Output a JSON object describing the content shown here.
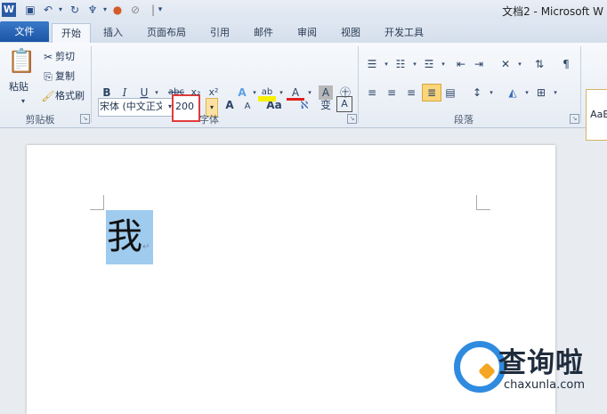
{
  "title_bar": {
    "app_icon": "W",
    "quick_access": [
      "save-icon",
      "undo-icon",
      "redo-icon",
      "format-painter-icon",
      "color-icon",
      "clear-icon",
      "customize-icon"
    ],
    "document_title": "文档2 - Microsoft W"
  },
  "tabs": [
    "文件",
    "开始",
    "插入",
    "页面布局",
    "引用",
    "邮件",
    "审阅",
    "视图",
    "开发工具"
  ],
  "active_tab": "开始",
  "clipboard": {
    "paste": "粘贴",
    "cut": "剪切",
    "copy": "复制",
    "format_painter": "格式刷",
    "label": "剪贴板"
  },
  "font": {
    "font_name": "宋体 (中文正文)",
    "font_size": "200",
    "grow": "A",
    "shrink": "A",
    "change_case": "Aa",
    "bold": "B",
    "italic": "I",
    "underline": "U",
    "strikethrough": "abc",
    "subscript": "x₂",
    "superscript": "x²",
    "text_effect": "A",
    "highlight": "ab",
    "font_color": "A",
    "char_shading": "A",
    "label": "字体",
    "phonetic": "变",
    "border": "A"
  },
  "paragraph": {
    "label": "段落"
  },
  "styles": {
    "preview": "AaB"
  },
  "document": {
    "text": "我",
    "paragraph_mark": "↵"
  },
  "watermark": {
    "title": "查询啦",
    "url": "chaxunla.com"
  },
  "colors": {
    "file_tab": "#1c54a4",
    "selection": "#9fcbee",
    "highlight_box": "#e03a3a",
    "watermark_blue": "#2f8be0",
    "watermark_orange": "#f5a623"
  }
}
